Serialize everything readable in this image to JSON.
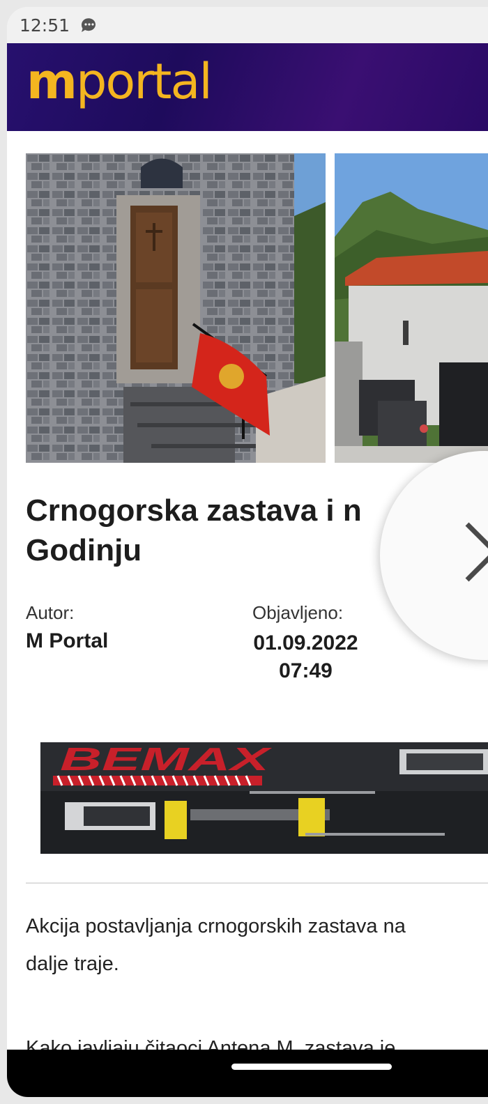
{
  "status_bar": {
    "time": "12:51"
  },
  "header": {
    "logo_m": "m",
    "logo_rest": "portal"
  },
  "article": {
    "title_line1": "Crnogorska zastava i n",
    "title_line2": "Godinju",
    "author_label": "Autor:",
    "author_value": "M Portal",
    "published_label": "Objavljeno:",
    "published_date": "01.09.2022",
    "published_time": "07:49",
    "body_line1": "Akcija postavljanja crnogorskih zastava na",
    "body_line2": "dalje traje.",
    "body_cut": "Kako javljaju čitaoci Antena M, zastava je"
  },
  "ad": {
    "brand": "BEMAX"
  },
  "colors": {
    "header_bg": "#27106e",
    "logo": "#f4b520",
    "flag_red": "#d4251b"
  }
}
